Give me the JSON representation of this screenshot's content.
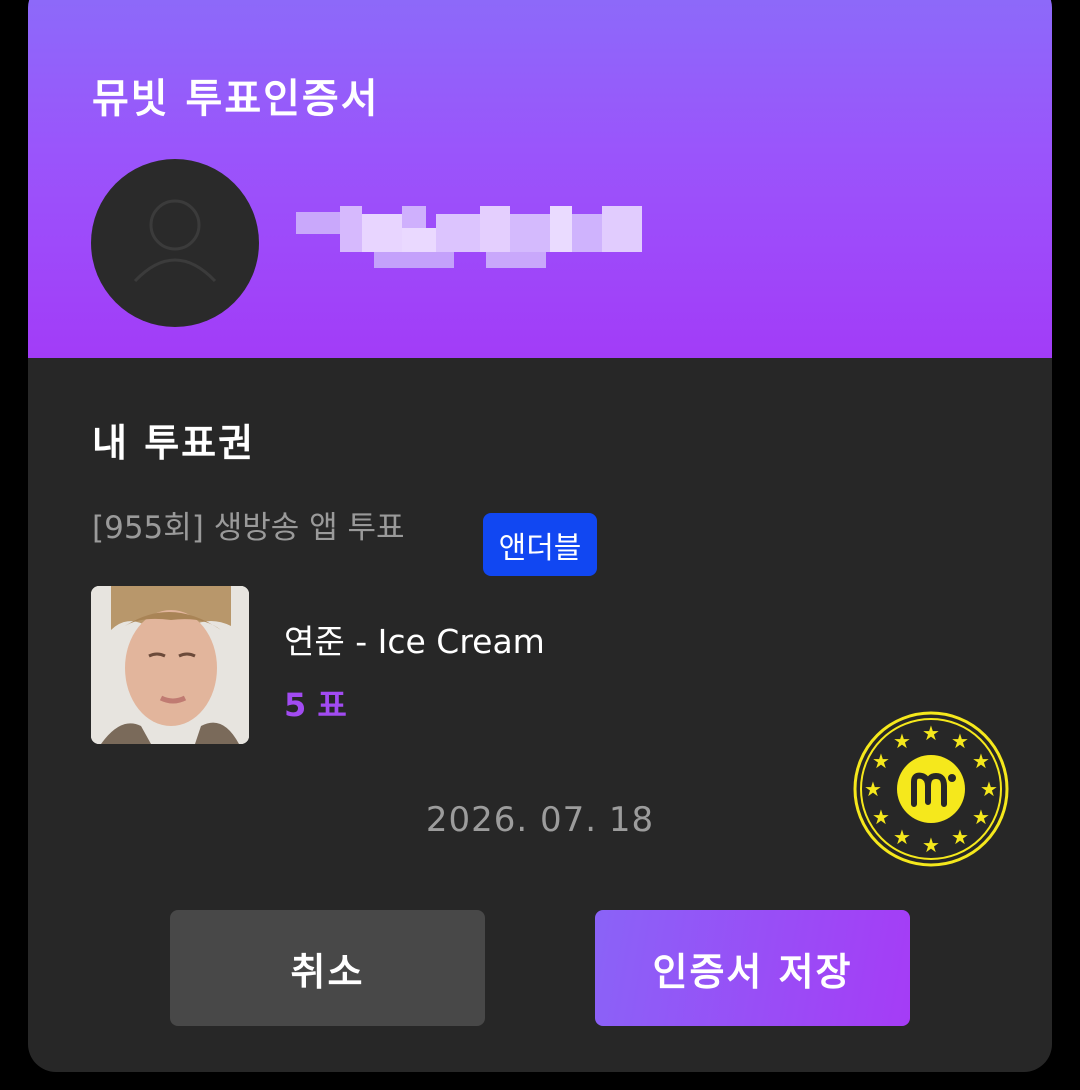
{
  "header": {
    "title": "뮤빗 투표인증서",
    "avatar_icon": "user-placeholder-icon",
    "username_blurred": true
  },
  "ticket": {
    "section_title": "내 투표권",
    "vote_round": "[955회] 생방송 앱 투표",
    "badge": "앤더블",
    "song": "연준 - Ice Cream",
    "votes": "5 표",
    "date": "2026. 07. 18",
    "seal_icon": "mubeat-seal-icon"
  },
  "actions": {
    "cancel_label": "취소",
    "save_label": "인증서 저장"
  },
  "colors": {
    "header_gradient_start": "#8b6cf9",
    "header_gradient_end": "#a23cf8",
    "card_bg": "#272727",
    "badge_bg": "#1147f2",
    "votes_text": "#a24bf2",
    "seal": "#f5e81c",
    "cancel_button": "#484848"
  }
}
